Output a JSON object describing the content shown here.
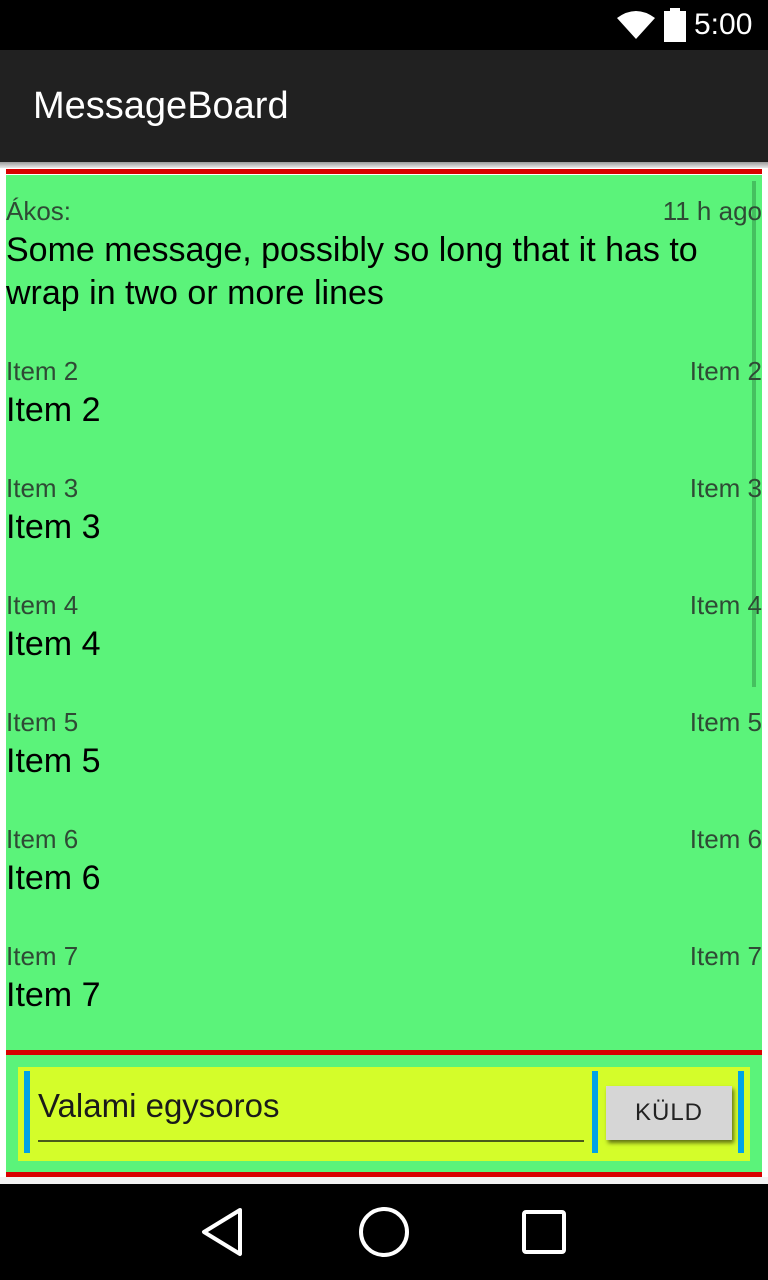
{
  "status_bar": {
    "time": "5:00",
    "icons": [
      "wifi-icon",
      "battery-icon"
    ]
  },
  "app_bar": {
    "title": "MessageBoard"
  },
  "messages": [
    {
      "author": "Ákos:",
      "time": "11 h ago",
      "text": "Some message, possibly so long that it has to wrap in two or more lines"
    },
    {
      "author": "Item 2",
      "time": "Item 2",
      "text": "Item 2"
    },
    {
      "author": "Item 3",
      "time": "Item 3",
      "text": "Item 3"
    },
    {
      "author": "Item 4",
      "time": "Item 4",
      "text": "Item 4"
    },
    {
      "author": "Item 5",
      "time": "Item 5",
      "text": "Item 5"
    },
    {
      "author": "Item 6",
      "time": "Item 6",
      "text": "Item 6"
    },
    {
      "author": "Item 7",
      "time": "Item 7",
      "text": "Item 7"
    }
  ],
  "composer": {
    "input_value": "Valami egysoros",
    "send_label": "KÜLD"
  },
  "nav_bar": {
    "icons": [
      "back-icon",
      "home-icon",
      "recents-icon"
    ]
  },
  "colors": {
    "list_background": "#5bf37a",
    "input_background": "#d4fd2a",
    "separator_red": "#d80000",
    "accent_blue": "#00a3e6",
    "app_bar": "#212121"
  }
}
